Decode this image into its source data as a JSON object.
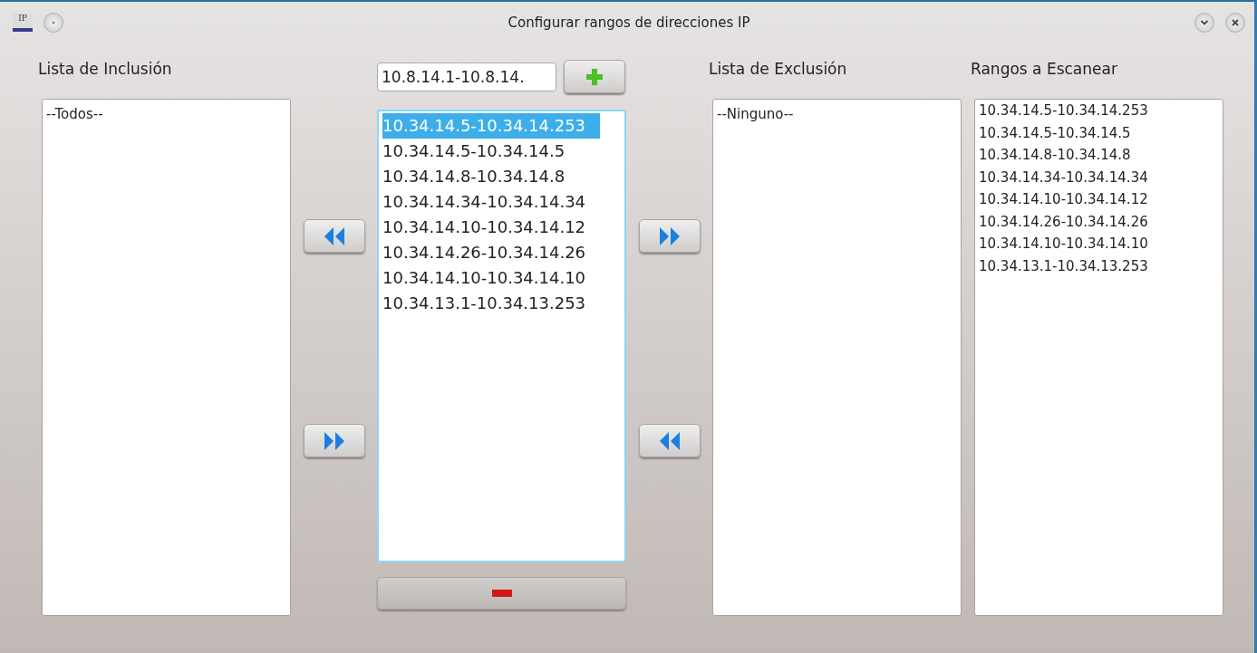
{
  "window": {
    "title": "Configurar rangos de direcciones IP",
    "app_icon_label": "IP"
  },
  "inclusion": {
    "label": "Lista de Inclusión",
    "items": [
      "--Todos--"
    ]
  },
  "range_field": {
    "value": "10.8.14.1-10.8.14."
  },
  "ranges": [
    {
      "text": "10.34.14.5-10.34.14.253",
      "selected": true
    },
    {
      "text": "10.34.14.5-10.34.14.5",
      "selected": false
    },
    {
      "text": "10.34.14.8-10.34.14.8",
      "selected": false
    },
    {
      "text": "10.34.14.34-10.34.14.34",
      "selected": false
    },
    {
      "text": "10.34.14.10-10.34.14.12",
      "selected": false
    },
    {
      "text": "10.34.14.26-10.34.14.26",
      "selected": false
    },
    {
      "text": "10.34.14.10-10.34.14.10",
      "selected": false
    },
    {
      "text": "10.34.13.1-10.34.13.253",
      "selected": false
    }
  ],
  "exclusion": {
    "label": "Lista de Exclusión",
    "items": [
      "--Ninguno--"
    ]
  },
  "scan": {
    "label": "Rangos a Escanear",
    "items": [
      "10.34.14.5-10.34.14.253",
      "10.34.14.5-10.34.14.5",
      "10.34.14.8-10.34.14.8",
      "10.34.14.34-10.34.14.34",
      "10.34.14.10-10.34.14.12",
      "10.34.14.26-10.34.14.26",
      "10.34.14.10-10.34.14.10",
      "10.34.13.1-10.34.13.253"
    ]
  }
}
